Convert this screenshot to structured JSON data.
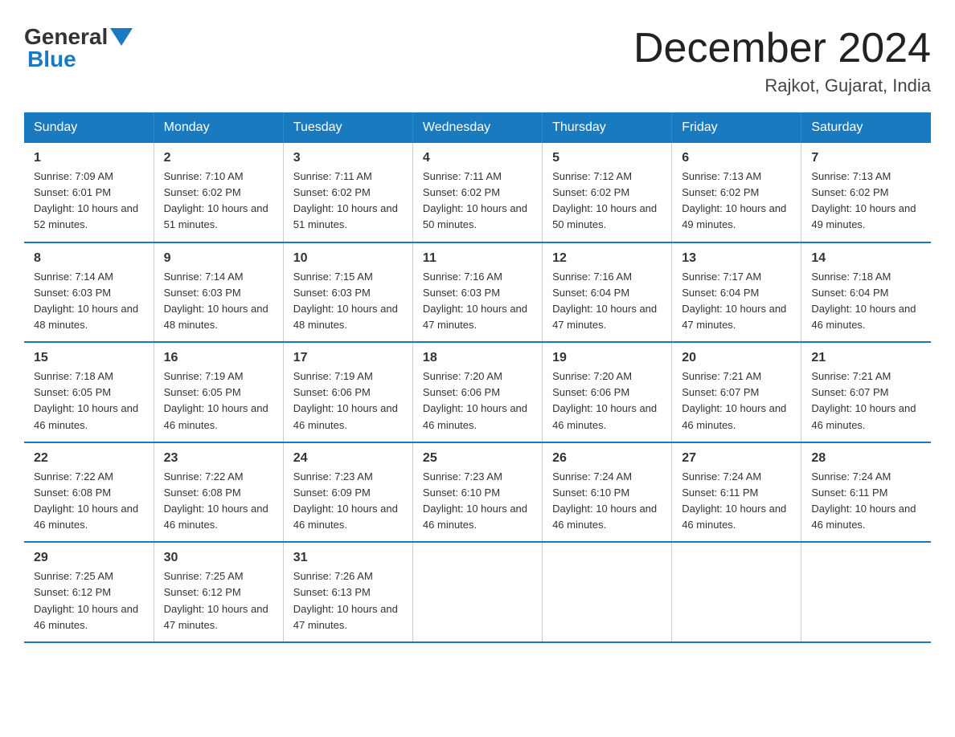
{
  "logo": {
    "text_general": "General",
    "text_blue": "Blue"
  },
  "title": "December 2024",
  "subtitle": "Rajkot, Gujarat, India",
  "days_of_week": [
    "Sunday",
    "Monday",
    "Tuesday",
    "Wednesday",
    "Thursday",
    "Friday",
    "Saturday"
  ],
  "weeks": [
    [
      {
        "day": "1",
        "sunrise": "7:09 AM",
        "sunset": "6:01 PM",
        "daylight": "10 hours and 52 minutes."
      },
      {
        "day": "2",
        "sunrise": "7:10 AM",
        "sunset": "6:02 PM",
        "daylight": "10 hours and 51 minutes."
      },
      {
        "day": "3",
        "sunrise": "7:11 AM",
        "sunset": "6:02 PM",
        "daylight": "10 hours and 51 minutes."
      },
      {
        "day": "4",
        "sunrise": "7:11 AM",
        "sunset": "6:02 PM",
        "daylight": "10 hours and 50 minutes."
      },
      {
        "day": "5",
        "sunrise": "7:12 AM",
        "sunset": "6:02 PM",
        "daylight": "10 hours and 50 minutes."
      },
      {
        "day": "6",
        "sunrise": "7:13 AM",
        "sunset": "6:02 PM",
        "daylight": "10 hours and 49 minutes."
      },
      {
        "day": "7",
        "sunrise": "7:13 AM",
        "sunset": "6:02 PM",
        "daylight": "10 hours and 49 minutes."
      }
    ],
    [
      {
        "day": "8",
        "sunrise": "7:14 AM",
        "sunset": "6:03 PM",
        "daylight": "10 hours and 48 minutes."
      },
      {
        "day": "9",
        "sunrise": "7:14 AM",
        "sunset": "6:03 PM",
        "daylight": "10 hours and 48 minutes."
      },
      {
        "day": "10",
        "sunrise": "7:15 AM",
        "sunset": "6:03 PM",
        "daylight": "10 hours and 48 minutes."
      },
      {
        "day": "11",
        "sunrise": "7:16 AM",
        "sunset": "6:03 PM",
        "daylight": "10 hours and 47 minutes."
      },
      {
        "day": "12",
        "sunrise": "7:16 AM",
        "sunset": "6:04 PM",
        "daylight": "10 hours and 47 minutes."
      },
      {
        "day": "13",
        "sunrise": "7:17 AM",
        "sunset": "6:04 PM",
        "daylight": "10 hours and 47 minutes."
      },
      {
        "day": "14",
        "sunrise": "7:18 AM",
        "sunset": "6:04 PM",
        "daylight": "10 hours and 46 minutes."
      }
    ],
    [
      {
        "day": "15",
        "sunrise": "7:18 AM",
        "sunset": "6:05 PM",
        "daylight": "10 hours and 46 minutes."
      },
      {
        "day": "16",
        "sunrise": "7:19 AM",
        "sunset": "6:05 PM",
        "daylight": "10 hours and 46 minutes."
      },
      {
        "day": "17",
        "sunrise": "7:19 AM",
        "sunset": "6:06 PM",
        "daylight": "10 hours and 46 minutes."
      },
      {
        "day": "18",
        "sunrise": "7:20 AM",
        "sunset": "6:06 PM",
        "daylight": "10 hours and 46 minutes."
      },
      {
        "day": "19",
        "sunrise": "7:20 AM",
        "sunset": "6:06 PM",
        "daylight": "10 hours and 46 minutes."
      },
      {
        "day": "20",
        "sunrise": "7:21 AM",
        "sunset": "6:07 PM",
        "daylight": "10 hours and 46 minutes."
      },
      {
        "day": "21",
        "sunrise": "7:21 AM",
        "sunset": "6:07 PM",
        "daylight": "10 hours and 46 minutes."
      }
    ],
    [
      {
        "day": "22",
        "sunrise": "7:22 AM",
        "sunset": "6:08 PM",
        "daylight": "10 hours and 46 minutes."
      },
      {
        "day": "23",
        "sunrise": "7:22 AM",
        "sunset": "6:08 PM",
        "daylight": "10 hours and 46 minutes."
      },
      {
        "day": "24",
        "sunrise": "7:23 AM",
        "sunset": "6:09 PM",
        "daylight": "10 hours and 46 minutes."
      },
      {
        "day": "25",
        "sunrise": "7:23 AM",
        "sunset": "6:10 PM",
        "daylight": "10 hours and 46 minutes."
      },
      {
        "day": "26",
        "sunrise": "7:24 AM",
        "sunset": "6:10 PM",
        "daylight": "10 hours and 46 minutes."
      },
      {
        "day": "27",
        "sunrise": "7:24 AM",
        "sunset": "6:11 PM",
        "daylight": "10 hours and 46 minutes."
      },
      {
        "day": "28",
        "sunrise": "7:24 AM",
        "sunset": "6:11 PM",
        "daylight": "10 hours and 46 minutes."
      }
    ],
    [
      {
        "day": "29",
        "sunrise": "7:25 AM",
        "sunset": "6:12 PM",
        "daylight": "10 hours and 46 minutes."
      },
      {
        "day": "30",
        "sunrise": "7:25 AM",
        "sunset": "6:12 PM",
        "daylight": "10 hours and 47 minutes."
      },
      {
        "day": "31",
        "sunrise": "7:26 AM",
        "sunset": "6:13 PM",
        "daylight": "10 hours and 47 minutes."
      },
      null,
      null,
      null,
      null
    ]
  ]
}
